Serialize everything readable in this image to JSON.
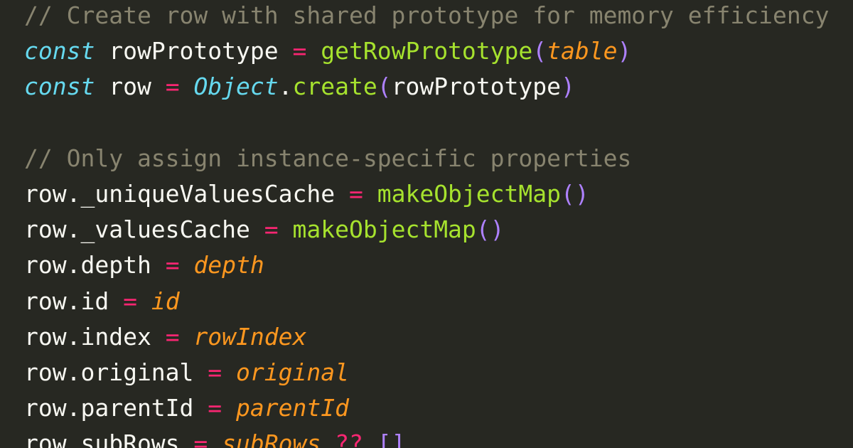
{
  "code": {
    "lines": [
      {
        "tokens": [
          {
            "text": "// Create row with shared prototype for memory efficiency",
            "kind": "comment"
          }
        ]
      },
      {
        "tokens": [
          {
            "text": "const",
            "kind": "keyword"
          },
          {
            "text": " rowPrototype ",
            "kind": "plain"
          },
          {
            "text": "=",
            "kind": "operator"
          },
          {
            "text": " ",
            "kind": "plain"
          },
          {
            "text": "getRowPrototype",
            "kind": "function"
          },
          {
            "text": "(",
            "kind": "paren"
          },
          {
            "text": "table",
            "kind": "param"
          },
          {
            "text": ")",
            "kind": "paren"
          }
        ]
      },
      {
        "tokens": [
          {
            "text": "const",
            "kind": "keyword"
          },
          {
            "text": " row ",
            "kind": "plain"
          },
          {
            "text": "=",
            "kind": "operator"
          },
          {
            "text": " ",
            "kind": "plain"
          },
          {
            "text": "Object",
            "kind": "builtin"
          },
          {
            "text": ".",
            "kind": "punct"
          },
          {
            "text": "create",
            "kind": "function"
          },
          {
            "text": "(",
            "kind": "paren"
          },
          {
            "text": "rowPrototype",
            "kind": "plain"
          },
          {
            "text": ")",
            "kind": "paren"
          }
        ]
      },
      {
        "tokens": []
      },
      {
        "tokens": [
          {
            "text": "// Only assign instance-specific properties",
            "kind": "comment"
          }
        ]
      },
      {
        "tokens": [
          {
            "text": "row._uniqueValuesCache ",
            "kind": "plain"
          },
          {
            "text": "=",
            "kind": "operator"
          },
          {
            "text": " ",
            "kind": "plain"
          },
          {
            "text": "makeObjectMap",
            "kind": "function"
          },
          {
            "text": "()",
            "kind": "paren"
          }
        ]
      },
      {
        "tokens": [
          {
            "text": "row._valuesCache ",
            "kind": "plain"
          },
          {
            "text": "=",
            "kind": "operator"
          },
          {
            "text": " ",
            "kind": "plain"
          },
          {
            "text": "makeObjectMap",
            "kind": "function"
          },
          {
            "text": "()",
            "kind": "paren"
          }
        ]
      },
      {
        "tokens": [
          {
            "text": "row.depth ",
            "kind": "plain"
          },
          {
            "text": "=",
            "kind": "operator"
          },
          {
            "text": " ",
            "kind": "plain"
          },
          {
            "text": "depth",
            "kind": "param"
          }
        ]
      },
      {
        "tokens": [
          {
            "text": "row.id ",
            "kind": "plain"
          },
          {
            "text": "=",
            "kind": "operator"
          },
          {
            "text": " ",
            "kind": "plain"
          },
          {
            "text": "id",
            "kind": "param"
          }
        ]
      },
      {
        "tokens": [
          {
            "text": "row.index ",
            "kind": "plain"
          },
          {
            "text": "=",
            "kind": "operator"
          },
          {
            "text": " ",
            "kind": "plain"
          },
          {
            "text": "rowIndex",
            "kind": "param"
          }
        ]
      },
      {
        "tokens": [
          {
            "text": "row.original ",
            "kind": "plain"
          },
          {
            "text": "=",
            "kind": "operator"
          },
          {
            "text": " ",
            "kind": "plain"
          },
          {
            "text": "original",
            "kind": "param"
          }
        ]
      },
      {
        "tokens": [
          {
            "text": "row.parentId ",
            "kind": "plain"
          },
          {
            "text": "=",
            "kind": "operator"
          },
          {
            "text": " ",
            "kind": "plain"
          },
          {
            "text": "parentId",
            "kind": "param"
          }
        ]
      },
      {
        "tokens": [
          {
            "text": "row.subRows ",
            "kind": "plain"
          },
          {
            "text": "=",
            "kind": "operator"
          },
          {
            "text": " ",
            "kind": "plain"
          },
          {
            "text": "subRows",
            "kind": "param"
          },
          {
            "text": " ",
            "kind": "plain"
          },
          {
            "text": "??",
            "kind": "operator"
          },
          {
            "text": " ",
            "kind": "plain"
          },
          {
            "text": "[]",
            "kind": "paren"
          }
        ]
      }
    ]
  },
  "colors": {
    "background": "#272822",
    "plain": "#f8f8f2",
    "comment": "#88846f",
    "keyword": "#66d9ef",
    "operator": "#f92672",
    "function": "#a6e22e",
    "param": "#fd971f",
    "paren": "#ae81ff"
  }
}
